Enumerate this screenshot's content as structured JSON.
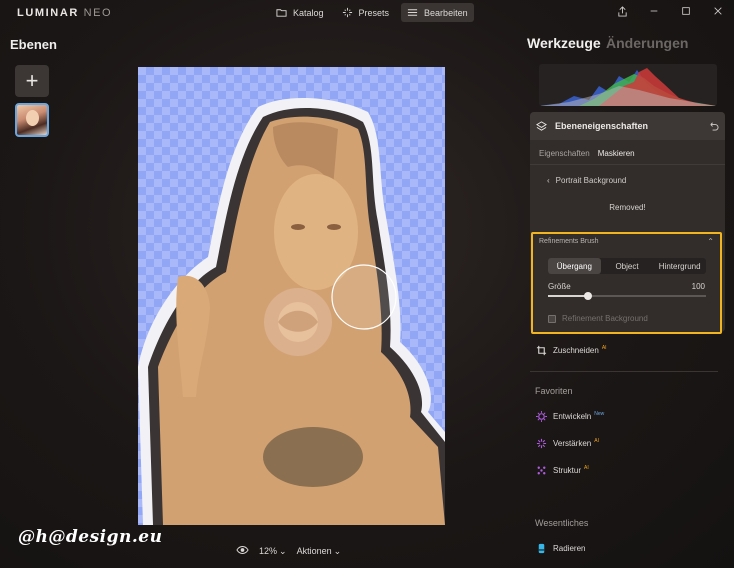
{
  "app": {
    "logo_main": "LUMINAR",
    "logo_sub": "NEO"
  },
  "topnav": [
    {
      "label": "Katalog",
      "icon": "folder-icon",
      "active": false
    },
    {
      "label": "Presets",
      "icon": "sparkle-icon",
      "active": false
    },
    {
      "label": "Bearbeiten",
      "icon": "sliders-icon",
      "active": true
    }
  ],
  "left": {
    "title": "Ebenen",
    "add_label": "+"
  },
  "bottom": {
    "zoom": "12%",
    "actions": "Aktionen"
  },
  "watermark": "@h@design.eu",
  "right": {
    "tab_tools": "Werkzeuge",
    "tab_changes": "Änderungen",
    "props_title": "Ebeneneigenschaften",
    "subtabs": [
      "Eigenschaften",
      "Maskieren"
    ],
    "portrait": "Portrait Background",
    "status": "Removed!",
    "refine": {
      "title": "Refinements Brush",
      "modes": [
        "Übergang",
        "Object",
        "Hintergrund"
      ],
      "active_mode": 0,
      "size_label": "Größe",
      "size_value": "100",
      "size_fraction": 0.25,
      "checkbox_label": "Refinement Background"
    },
    "crop": {
      "label": "Zuschneiden",
      "badge": "AI"
    },
    "favorites_title": "Favoriten",
    "favorites": [
      {
        "label": "Entwickeln",
        "badge": "New",
        "icon": "develop-icon"
      },
      {
        "label": "Verstärken",
        "badge": "AI",
        "icon": "enhance-icon"
      },
      {
        "label": "Struktur",
        "badge": "AI",
        "icon": "structure-icon"
      }
    ],
    "essentials_title": "Wesentliches",
    "essentials": [
      {
        "label": "Radieren",
        "icon": "eraser-icon"
      }
    ]
  },
  "colors": {
    "highlight": "#f3b51f",
    "accent_purple": "#b05ce0",
    "accent_blue": "#6aa6e0"
  }
}
